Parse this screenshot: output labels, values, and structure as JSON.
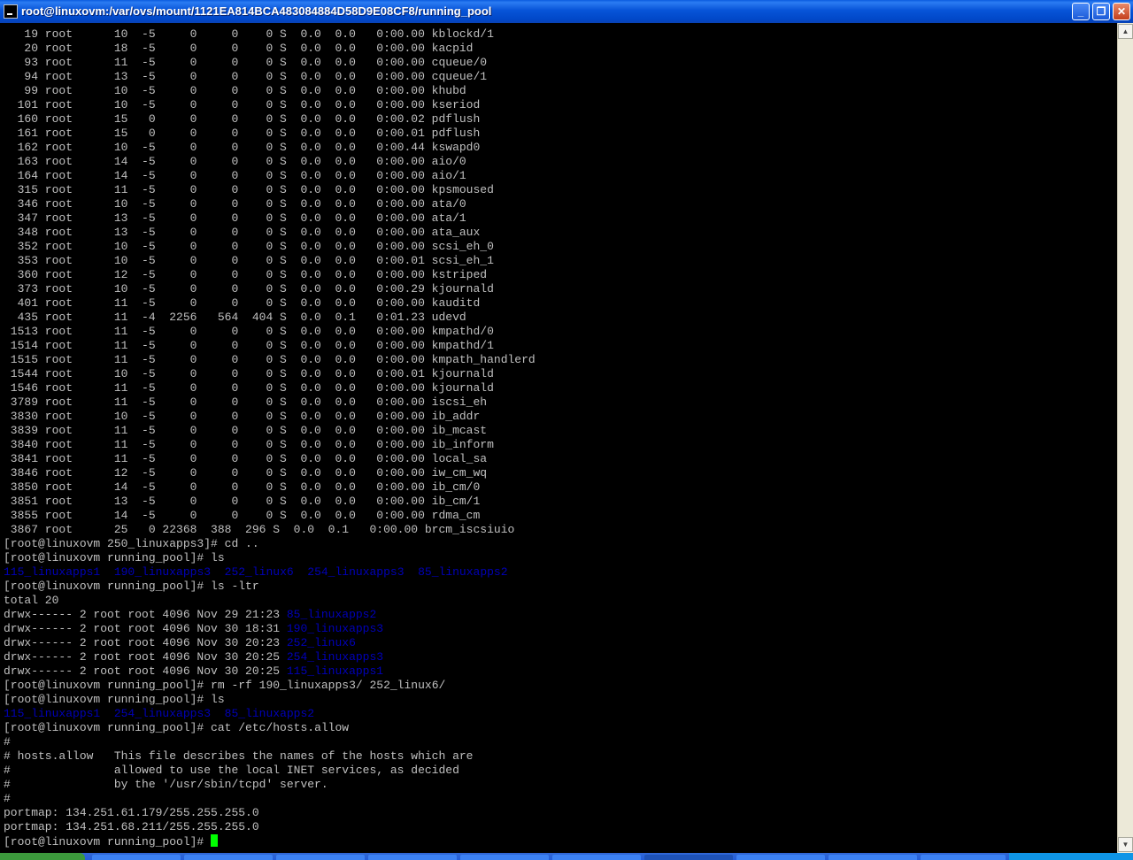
{
  "window": {
    "title": "root@linuxovm:/var/ovs/mount/1121EA814BCA483084884D58D9E08CF8/running_pool",
    "min_glyph": "_",
    "max_glyph": "❐",
    "close_glyph": "✕",
    "scroll_up_glyph": "▲",
    "scroll_down_glyph": "▼"
  },
  "terminal": {
    "colors": {
      "fg": "#c0c0c0",
      "bg": "#000000",
      "dir": "#0000b8",
      "cursor": "#00ff00"
    },
    "process_rows": [
      "   19 root      10  -5     0     0    0 S  0.0  0.0   0:00.00 kblockd/1",
      "   20 root      18  -5     0     0    0 S  0.0  0.0   0:00.00 kacpid",
      "   93 root      11  -5     0     0    0 S  0.0  0.0   0:00.00 cqueue/0",
      "   94 root      13  -5     0     0    0 S  0.0  0.0   0:00.00 cqueue/1",
      "   99 root      10  -5     0     0    0 S  0.0  0.0   0:00.00 khubd",
      "  101 root      10  -5     0     0    0 S  0.0  0.0   0:00.00 kseriod",
      "  160 root      15   0     0     0    0 S  0.0  0.0   0:00.02 pdflush",
      "  161 root      15   0     0     0    0 S  0.0  0.0   0:00.01 pdflush",
      "  162 root      10  -5     0     0    0 S  0.0  0.0   0:00.44 kswapd0",
      "  163 root      14  -5     0     0    0 S  0.0  0.0   0:00.00 aio/0",
      "  164 root      14  -5     0     0    0 S  0.0  0.0   0:00.00 aio/1",
      "  315 root      11  -5     0     0    0 S  0.0  0.0   0:00.00 kpsmoused",
      "  346 root      10  -5     0     0    0 S  0.0  0.0   0:00.00 ata/0",
      "  347 root      13  -5     0     0    0 S  0.0  0.0   0:00.00 ata/1",
      "  348 root      13  -5     0     0    0 S  0.0  0.0   0:00.00 ata_aux",
      "  352 root      10  -5     0     0    0 S  0.0  0.0   0:00.00 scsi_eh_0",
      "  353 root      10  -5     0     0    0 S  0.0  0.0   0:00.01 scsi_eh_1",
      "  360 root      12  -5     0     0    0 S  0.0  0.0   0:00.00 kstriped",
      "  373 root      10  -5     0     0    0 S  0.0  0.0   0:00.29 kjournald",
      "  401 root      11  -5     0     0    0 S  0.0  0.0   0:00.00 kauditd",
      "  435 root      11  -4  2256   564  404 S  0.0  0.1   0:01.23 udevd",
      " 1513 root      11  -5     0     0    0 S  0.0  0.0   0:00.00 kmpathd/0",
      " 1514 root      11  -5     0     0    0 S  0.0  0.0   0:00.00 kmpathd/1",
      " 1515 root      11  -5     0     0    0 S  0.0  0.0   0:00.00 kmpath_handlerd",
      " 1544 root      10  -5     0     0    0 S  0.0  0.0   0:00.01 kjournald",
      " 1546 root      11  -5     0     0    0 S  0.0  0.0   0:00.00 kjournald",
      " 3789 root      11  -5     0     0    0 S  0.0  0.0   0:00.00 iscsi_eh",
      " 3830 root      10  -5     0     0    0 S  0.0  0.0   0:00.00 ib_addr",
      " 3839 root      11  -5     0     0    0 S  0.0  0.0   0:00.00 ib_mcast",
      " 3840 root      11  -5     0     0    0 S  0.0  0.0   0:00.00 ib_inform",
      " 3841 root      11  -5     0     0    0 S  0.0  0.0   0:00.00 local_sa",
      " 3846 root      12  -5     0     0    0 S  0.0  0.0   0:00.00 iw_cm_wq",
      " 3850 root      14  -5     0     0    0 S  0.0  0.0   0:00.00 ib_cm/0",
      " 3851 root      13  -5     0     0    0 S  0.0  0.0   0:00.00 ib_cm/1",
      " 3855 root      14  -5     0     0    0 S  0.0  0.0   0:00.00 rdma_cm",
      " 3867 root      25   0 22368  388  296 S  0.0  0.1   0:00.00 brcm_iscsiuio"
    ],
    "prompt_running_pool": "[root@linuxovm running_pool]# ",
    "cmd_cd": {
      "prompt": "[root@linuxovm 250_linuxapps3]# ",
      "cmd": "cd .."
    },
    "cmd_ls1": "ls",
    "ls1_dirs": [
      "115_linuxapps1",
      "190_linuxapps3",
      "252_linux6",
      "254_linuxapps3",
      "85_linuxapps2"
    ],
    "cmd_ls_ltr": "ls -ltr",
    "total": "total 20",
    "ls_ltr_rows": [
      {
        "meta": "drwx------ 2 root root 4096 Nov 29 21:23 ",
        "name": "85_linuxapps2"
      },
      {
        "meta": "drwx------ 2 root root 4096 Nov 30 18:31 ",
        "name": "190_linuxapps3"
      },
      {
        "meta": "drwx------ 2 root root 4096 Nov 30 20:23 ",
        "name": "252_linux6"
      },
      {
        "meta": "drwx------ 2 root root 4096 Nov 30 20:25 ",
        "name": "254_linuxapps3"
      },
      {
        "meta": "drwx------ 2 root root 4096 Nov 30 20:25 ",
        "name": "115_linuxapps1"
      }
    ],
    "cmd_rm": "rm -rf 190_linuxapps3/ 252_linux6/",
    "cmd_ls2": "ls",
    "ls2_dirs": [
      "115_linuxapps1",
      "254_linuxapps3",
      "85_linuxapps2"
    ],
    "cmd_cat": "cat /etc/hosts.allow",
    "hosts_allow_lines": [
      "#",
      "# hosts.allow   This file describes the names of the hosts which are",
      "#               allowed to use the local INET services, as decided",
      "#               by the '/usr/sbin/tcpd' server.",
      "#",
      "portmap: 134.251.61.179/255.255.255.0",
      "portmap: 134.251.68.211/255.255.255.0"
    ]
  }
}
